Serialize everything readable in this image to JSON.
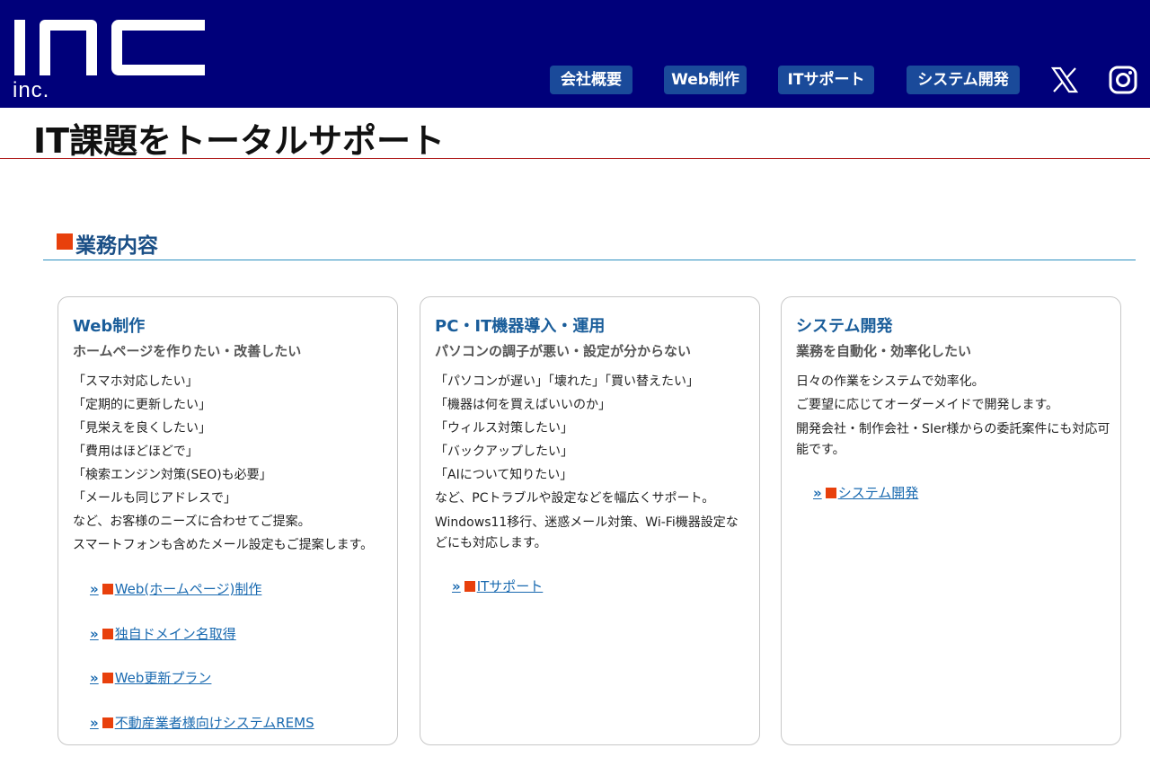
{
  "header": {
    "logo_text": "INC inc.",
    "nav": [
      "会社概要",
      "Web制作",
      "ITサポート",
      "システム開発"
    ],
    "social": [
      {
        "icon": "x-icon"
      },
      {
        "icon": "instagram-icon"
      }
    ],
    "colors": {
      "background": "#00007a",
      "nav_button": "#1a4a9a"
    }
  },
  "hero": {
    "title": "IT課題をトータルサポート"
  },
  "section": {
    "title": "業務内容",
    "mark_color": "#e8400c"
  },
  "cards": [
    {
      "title": "Web制作",
      "subtitle": "ホームページを作りたい・改善したい",
      "lines": [
        "「スマホ対応したい」",
        "「定期的に更新したい」",
        "「見栄えを良くしたい」",
        "「費用はほどほどで」",
        "「検索エンジン対策(SEO)も必要」",
        "「メールも同じアドレスで」",
        "など、お客様のニーズに合わせてご提案。",
        "スマートフォンも含めたメール設定もご提案します。"
      ],
      "links": [
        "Web(ホームページ)制作",
        "独自ドメイン名取得",
        "Web更新プラン",
        "不動産業者様向けシステムREMS"
      ]
    },
    {
      "title": "PC・IT機器導入・運用",
      "subtitle": "パソコンの調子が悪い・設定が分からない",
      "lines": [
        "「パソコンが遅い」「壊れた」「買い替えたい」",
        "「機器は何を買えばいいのか」",
        "「ウィルス対策したい」",
        "「バックアップしたい」",
        "「AIについて知りたい」",
        "など、PCトラブルや設定などを幅広くサポート。",
        "Windows11移行、迷惑メール対策、Wi-Fi機器設定などにも対応します。"
      ],
      "links": [
        "ITサポート"
      ]
    },
    {
      "title": "システム開発",
      "subtitle": "業務を自動化・効率化したい",
      "lines": [
        "日々の作業をシステムで効率化。",
        "ご要望に応じてオーダーメイドで開発します。",
        "開発会社・制作会社・SIer様からの委託案件にも対応可能です。"
      ],
      "links": [
        "システム開発"
      ]
    }
  ]
}
